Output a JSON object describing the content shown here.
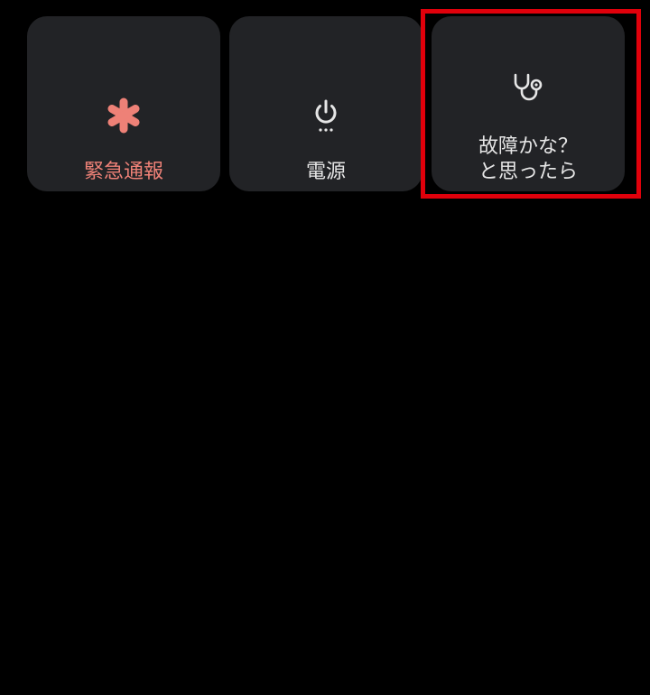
{
  "tiles": {
    "emergency": {
      "label": "緊急通報",
      "icon": "asterisk-icon",
      "color": "#ee8177"
    },
    "power": {
      "label": "電源",
      "icon": "power-icon"
    },
    "troubleshoot": {
      "label_line1": "故障かな？",
      "label_line2": "と思ったら",
      "icon": "stethoscope-icon"
    }
  },
  "colors": {
    "background": "#000000",
    "tile": "#222326",
    "text": "#e6e6e6",
    "highlight": "#e0000b"
  }
}
